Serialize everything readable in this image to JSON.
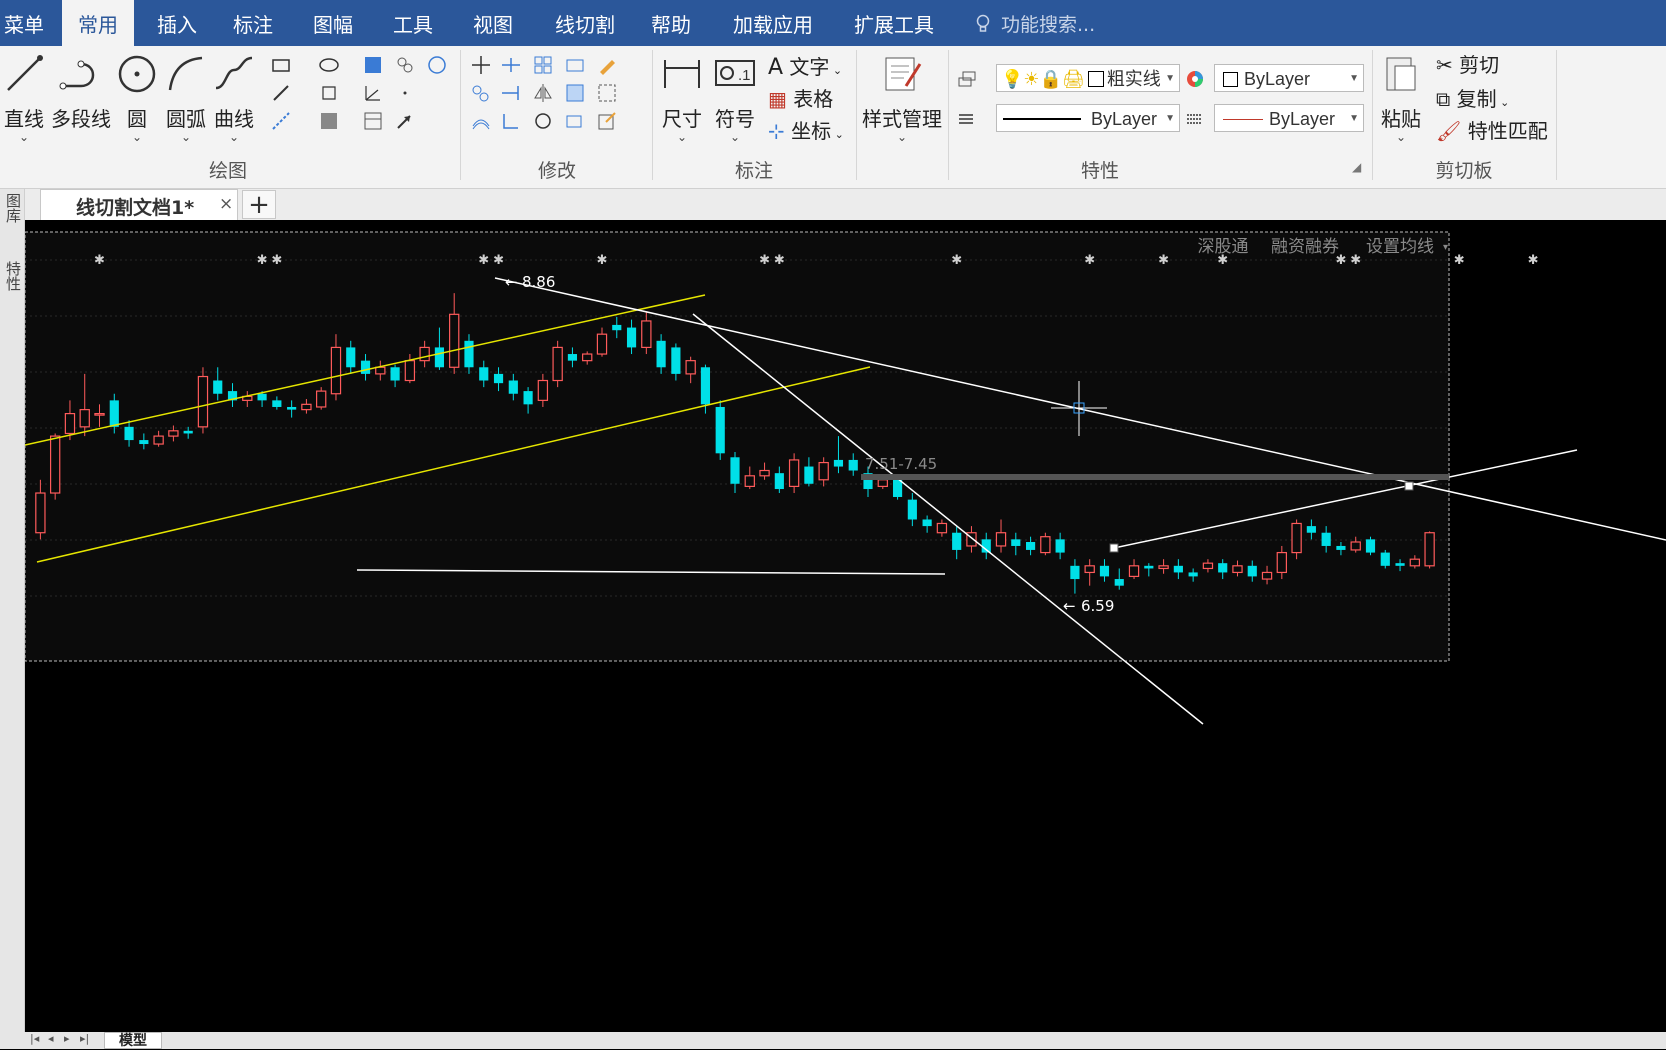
{
  "menu": {
    "items": [
      "菜单",
      "常用",
      "插入",
      "标注",
      "图幅",
      "工具",
      "视图",
      "线切割",
      "帮助",
      "加载应用",
      "扩展工具"
    ],
    "active_index": 1,
    "search_placeholder": "功能搜索..."
  },
  "ribbon": {
    "draw": {
      "label": "绘图",
      "tools": [
        "直线",
        "多段线",
        "圆",
        "圆弧",
        "曲线"
      ]
    },
    "modify": {
      "label": "修改"
    },
    "annotate": {
      "label": "标注",
      "size": "尺寸",
      "symbol": "符号",
      "text": "文字",
      "table": "表格",
      "coord": "坐标"
    },
    "style": {
      "label": "样式管理"
    },
    "properties": {
      "label": "特性",
      "layer": "粗实线",
      "color": "ByLayer",
      "linetype": "ByLayer",
      "lineweight": "ByLayer"
    },
    "clipboard": {
      "label": "剪切板",
      "paste": "粘贴",
      "cut": "剪切",
      "copy": "复制",
      "match": "特性匹配"
    }
  },
  "tabs": {
    "document": "线切割文档1*",
    "close": "×",
    "add": "+"
  },
  "side_panel": {
    "library": "图库",
    "properties": "特性"
  },
  "bottom": {
    "model_tab": "模型"
  },
  "chart_overlay": {
    "links": [
      "深股通",
      "融资融券",
      "设置均线"
    ],
    "high_label": "8.86",
    "low_label": "6.59",
    "range_label": "7.51-7.45"
  },
  "chart_data": {
    "type": "candlestick",
    "ylim": [
      6.3,
      9.05
    ],
    "candles": [
      [
        7.05,
        7.35,
        7.0,
        7.45
      ],
      [
        7.35,
        7.78,
        7.3,
        7.8
      ],
      [
        7.8,
        7.95,
        7.75,
        8.05
      ],
      [
        7.85,
        7.98,
        7.78,
        8.25
      ],
      [
        7.95,
        7.95,
        7.85,
        8.02
      ],
      [
        8.05,
        7.85,
        7.8,
        8.1
      ],
      [
        7.85,
        7.75,
        7.7,
        7.9
      ],
      [
        7.75,
        7.72,
        7.68,
        7.8
      ],
      [
        7.72,
        7.78,
        7.7,
        7.82
      ],
      [
        7.78,
        7.82,
        7.74,
        7.86
      ],
      [
        7.82,
        7.8,
        7.76,
        7.85
      ],
      [
        7.85,
        8.23,
        7.8,
        8.3
      ],
      [
        8.2,
        8.1,
        8.05,
        8.3
      ],
      [
        8.12,
        8.05,
        8.0,
        8.18
      ],
      [
        8.05,
        8.08,
        8.0,
        8.12
      ],
      [
        8.1,
        8.05,
        8.0,
        8.12
      ],
      [
        8.05,
        8.0,
        7.98,
        8.08
      ],
      [
        8.0,
        7.98,
        7.92,
        8.05
      ],
      [
        7.98,
        8.02,
        7.95,
        8.06
      ],
      [
        8.0,
        8.12,
        7.98,
        8.15
      ],
      [
        8.1,
        8.45,
        8.05,
        8.55
      ],
      [
        8.45,
        8.3,
        8.25,
        8.5
      ],
      [
        8.35,
        8.25,
        8.2,
        8.4
      ],
      [
        8.25,
        8.3,
        8.2,
        8.35
      ],
      [
        8.3,
        8.2,
        8.15,
        8.32
      ],
      [
        8.2,
        8.35,
        8.18,
        8.4
      ],
      [
        8.35,
        8.45,
        8.3,
        8.5
      ],
      [
        8.45,
        8.3,
        8.28,
        8.6
      ],
      [
        8.3,
        8.7,
        8.25,
        8.86
      ],
      [
        8.5,
        8.3,
        8.25,
        8.55
      ],
      [
        8.3,
        8.2,
        8.15,
        8.35
      ],
      [
        8.25,
        8.18,
        8.12,
        8.3
      ],
      [
        8.2,
        8.1,
        8.05,
        8.25
      ],
      [
        8.12,
        8.02,
        7.95,
        8.15
      ],
      [
        8.05,
        8.2,
        8.0,
        8.25
      ],
      [
        8.2,
        8.45,
        8.15,
        8.5
      ],
      [
        8.4,
        8.35,
        8.3,
        8.45
      ],
      [
        8.35,
        8.4,
        8.32,
        8.42
      ],
      [
        8.4,
        8.55,
        8.38,
        8.6
      ],
      [
        8.62,
        8.58,
        8.52,
        8.68
      ],
      [
        8.6,
        8.45,
        8.4,
        8.66
      ],
      [
        8.45,
        8.65,
        8.4,
        8.72
      ],
      [
        8.5,
        8.3,
        8.25,
        8.55
      ],
      [
        8.45,
        8.25,
        8.2,
        8.48
      ],
      [
        8.25,
        8.35,
        8.18,
        8.38
      ],
      [
        8.3,
        8.02,
        7.95,
        8.32
      ],
      [
        8.0,
        7.65,
        7.6,
        8.05
      ],
      [
        7.62,
        7.42,
        7.35,
        7.66
      ],
      [
        7.4,
        7.48,
        7.38,
        7.55
      ],
      [
        7.48,
        7.52,
        7.45,
        7.58
      ],
      [
        7.5,
        7.38,
        7.35,
        7.55
      ],
      [
        7.4,
        7.6,
        7.35,
        7.65
      ],
      [
        7.55,
        7.42,
        7.4,
        7.62
      ],
      [
        7.45,
        7.58,
        7.4,
        7.62
      ],
      [
        7.6,
        7.55,
        7.5,
        7.78
      ],
      [
        7.6,
        7.52,
        7.48,
        7.65
      ],
      [
        7.5,
        7.38,
        7.32,
        7.55
      ],
      [
        7.4,
        7.45,
        7.38,
        7.48
      ],
      [
        7.45,
        7.32,
        7.3,
        7.48
      ],
      [
        7.3,
        7.15,
        7.1,
        7.35
      ],
      [
        7.15,
        7.1,
        7.05,
        7.18
      ],
      [
        7.05,
        7.12,
        7.02,
        7.15
      ],
      [
        7.05,
        6.92,
        6.85,
        7.1
      ],
      [
        6.95,
        7.05,
        6.9,
        7.1
      ],
      [
        7.0,
        6.9,
        6.85,
        7.05
      ],
      [
        6.95,
        7.05,
        6.9,
        7.15
      ],
      [
        7.0,
        6.95,
        6.88,
        7.05
      ],
      [
        6.98,
        6.92,
        6.88,
        7.02
      ],
      [
        6.9,
        7.02,
        6.88,
        7.05
      ],
      [
        7.0,
        6.9,
        6.85,
        7.05
      ],
      [
        6.8,
        6.7,
        6.59,
        6.85
      ],
      [
        6.75,
        6.8,
        6.65,
        6.85
      ],
      [
        6.8,
        6.72,
        6.68,
        6.85
      ],
      [
        6.7,
        6.65,
        6.62,
        6.78
      ],
      [
        6.72,
        6.8,
        6.7,
        6.85
      ],
      [
        6.8,
        6.78,
        6.72,
        6.82
      ],
      [
        6.78,
        6.8,
        6.74,
        6.85
      ],
      [
        6.8,
        6.75,
        6.7,
        6.85
      ],
      [
        6.75,
        6.72,
        6.68,
        6.78
      ],
      [
        6.78,
        6.82,
        6.75,
        6.85
      ],
      [
        6.82,
        6.75,
        6.7,
        6.85
      ],
      [
        6.75,
        6.8,
        6.72,
        6.84
      ],
      [
        6.8,
        6.72,
        6.68,
        6.84
      ],
      [
        6.7,
        6.75,
        6.66,
        6.8
      ],
      [
        6.75,
        6.9,
        6.7,
        6.95
      ],
      [
        6.9,
        7.12,
        6.85,
        7.15
      ],
      [
        7.1,
        7.05,
        7.0,
        7.15
      ],
      [
        7.05,
        6.95,
        6.9,
        7.1
      ],
      [
        6.95,
        6.92,
        6.88,
        6.98
      ],
      [
        6.92,
        6.98,
        6.9,
        7.02
      ],
      [
        7.0,
        6.9,
        6.88,
        7.02
      ],
      [
        6.9,
        6.8,
        6.78,
        6.92
      ],
      [
        6.82,
        6.8,
        6.76,
        6.85
      ],
      [
        6.8,
        6.85,
        6.78,
        6.88
      ],
      [
        6.8,
        7.05,
        6.78,
        7.06
      ]
    ],
    "markers": [
      4,
      15,
      16,
      30,
      31,
      38,
      49,
      50,
      62,
      71,
      76,
      80,
      88,
      89,
      96,
      101
    ]
  }
}
